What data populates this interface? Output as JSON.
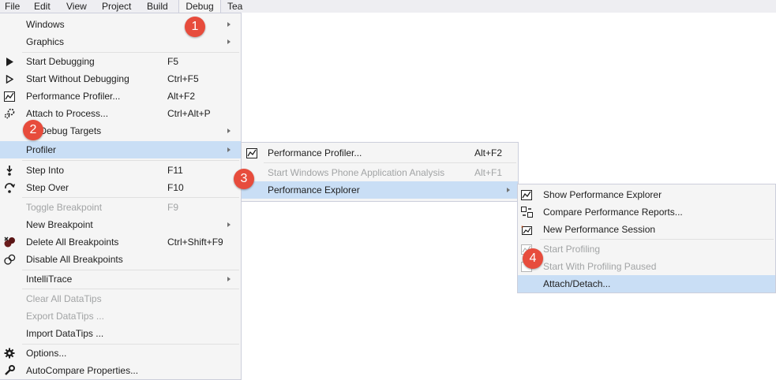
{
  "menubar": [
    "File",
    "Edit",
    "View",
    "Project",
    "Build",
    "Debug",
    "Tea"
  ],
  "debug_menu": {
    "items": [
      {
        "label": "Windows",
        "shortcut": "",
        "submenu": true,
        "disabled": false,
        "icon": ""
      },
      {
        "label": "Graphics",
        "shortcut": "",
        "submenu": true,
        "disabled": false,
        "icon": ""
      },
      {
        "label": "Start Debugging",
        "shortcut": "F5",
        "submenu": false,
        "disabled": false,
        "icon": "play-icon"
      },
      {
        "label": "Start Without Debugging",
        "shortcut": "Ctrl+F5",
        "submenu": false,
        "disabled": false,
        "icon": "play-outline-icon"
      },
      {
        "label": "Performance Profiler...",
        "shortcut": "Alt+F2",
        "submenu": false,
        "disabled": false,
        "icon": "performance-chart-icon"
      },
      {
        "label": "Attach to Process...",
        "shortcut": "Ctrl+Alt+P",
        "submenu": false,
        "disabled": false,
        "icon": "attach-process-icon"
      },
      {
        "label": "r Debug Targets",
        "shortcut": "",
        "submenu": true,
        "disabled": false,
        "icon": ""
      },
      {
        "label": "Profiler",
        "shortcut": "",
        "submenu": true,
        "disabled": false,
        "icon": "",
        "highlighted": true
      },
      {
        "label": "Step Into",
        "shortcut": "F11",
        "submenu": false,
        "disabled": false,
        "icon": "step-into-icon"
      },
      {
        "label": "Step Over",
        "shortcut": "F10",
        "submenu": false,
        "disabled": false,
        "icon": "step-over-icon"
      },
      {
        "label": "Toggle Breakpoint",
        "shortcut": "F9",
        "submenu": false,
        "disabled": true,
        "icon": ""
      },
      {
        "label": "New Breakpoint",
        "shortcut": "",
        "submenu": true,
        "disabled": false,
        "icon": ""
      },
      {
        "label": "Delete All Breakpoints",
        "shortcut": "Ctrl+Shift+F9",
        "submenu": false,
        "disabled": false,
        "icon": "delete-breakpoints-icon"
      },
      {
        "label": "Disable All Breakpoints",
        "shortcut": "",
        "submenu": false,
        "disabled": false,
        "icon": "disable-breakpoints-icon"
      },
      {
        "label": "IntelliTrace",
        "shortcut": "",
        "submenu": true,
        "disabled": false,
        "icon": ""
      },
      {
        "label": "Clear All DataTips",
        "shortcut": "",
        "submenu": false,
        "disabled": true,
        "icon": ""
      },
      {
        "label": "Export DataTips ...",
        "shortcut": "",
        "submenu": false,
        "disabled": true,
        "icon": ""
      },
      {
        "label": "Import DataTips ...",
        "shortcut": "",
        "submenu": false,
        "disabled": false,
        "icon": ""
      },
      {
        "label": "Options...",
        "shortcut": "",
        "submenu": false,
        "disabled": false,
        "icon": "gear-icon"
      },
      {
        "label": "AutoCompare Properties...",
        "shortcut": "",
        "submenu": false,
        "disabled": false,
        "icon": "wrench-icon"
      }
    ]
  },
  "profiler_menu": {
    "items": [
      {
        "label": "Performance Profiler...",
        "shortcut": "Alt+F2",
        "submenu": false,
        "disabled": false,
        "icon": "performance-chart-icon"
      },
      {
        "label": "Start Windows Phone Application Analysis",
        "shortcut": "Alt+F1",
        "submenu": false,
        "disabled": true,
        "icon": ""
      },
      {
        "label": "Performance Explorer",
        "shortcut": "",
        "submenu": true,
        "disabled": false,
        "icon": "",
        "highlighted": true
      }
    ]
  },
  "perf_explorer_menu": {
    "items": [
      {
        "label": "Show Performance Explorer",
        "disabled": false,
        "icon": "performance-explorer-icon"
      },
      {
        "label": "Compare Performance Reports...",
        "disabled": false,
        "icon": "compare-reports-icon"
      },
      {
        "label": "New Performance Session",
        "disabled": false,
        "icon": "new-session-icon"
      },
      {
        "label": "Start Profiling",
        "disabled": true,
        "icon": "start-profiling-icon"
      },
      {
        "label": "Start With Profiling Paused",
        "disabled": true,
        "icon": "profiling-paused-icon"
      },
      {
        "label": "Attach/Detach...",
        "disabled": false,
        "icon": "",
        "highlighted": true
      }
    ]
  },
  "callouts": [
    "1",
    "2",
    "3",
    "4"
  ],
  "colors": {
    "highlight": "#c9def5",
    "menu_bg": "#f5f5f5",
    "border": "#cccedb",
    "callout": "#e74c3c",
    "disabled": "#a2a4a5"
  }
}
